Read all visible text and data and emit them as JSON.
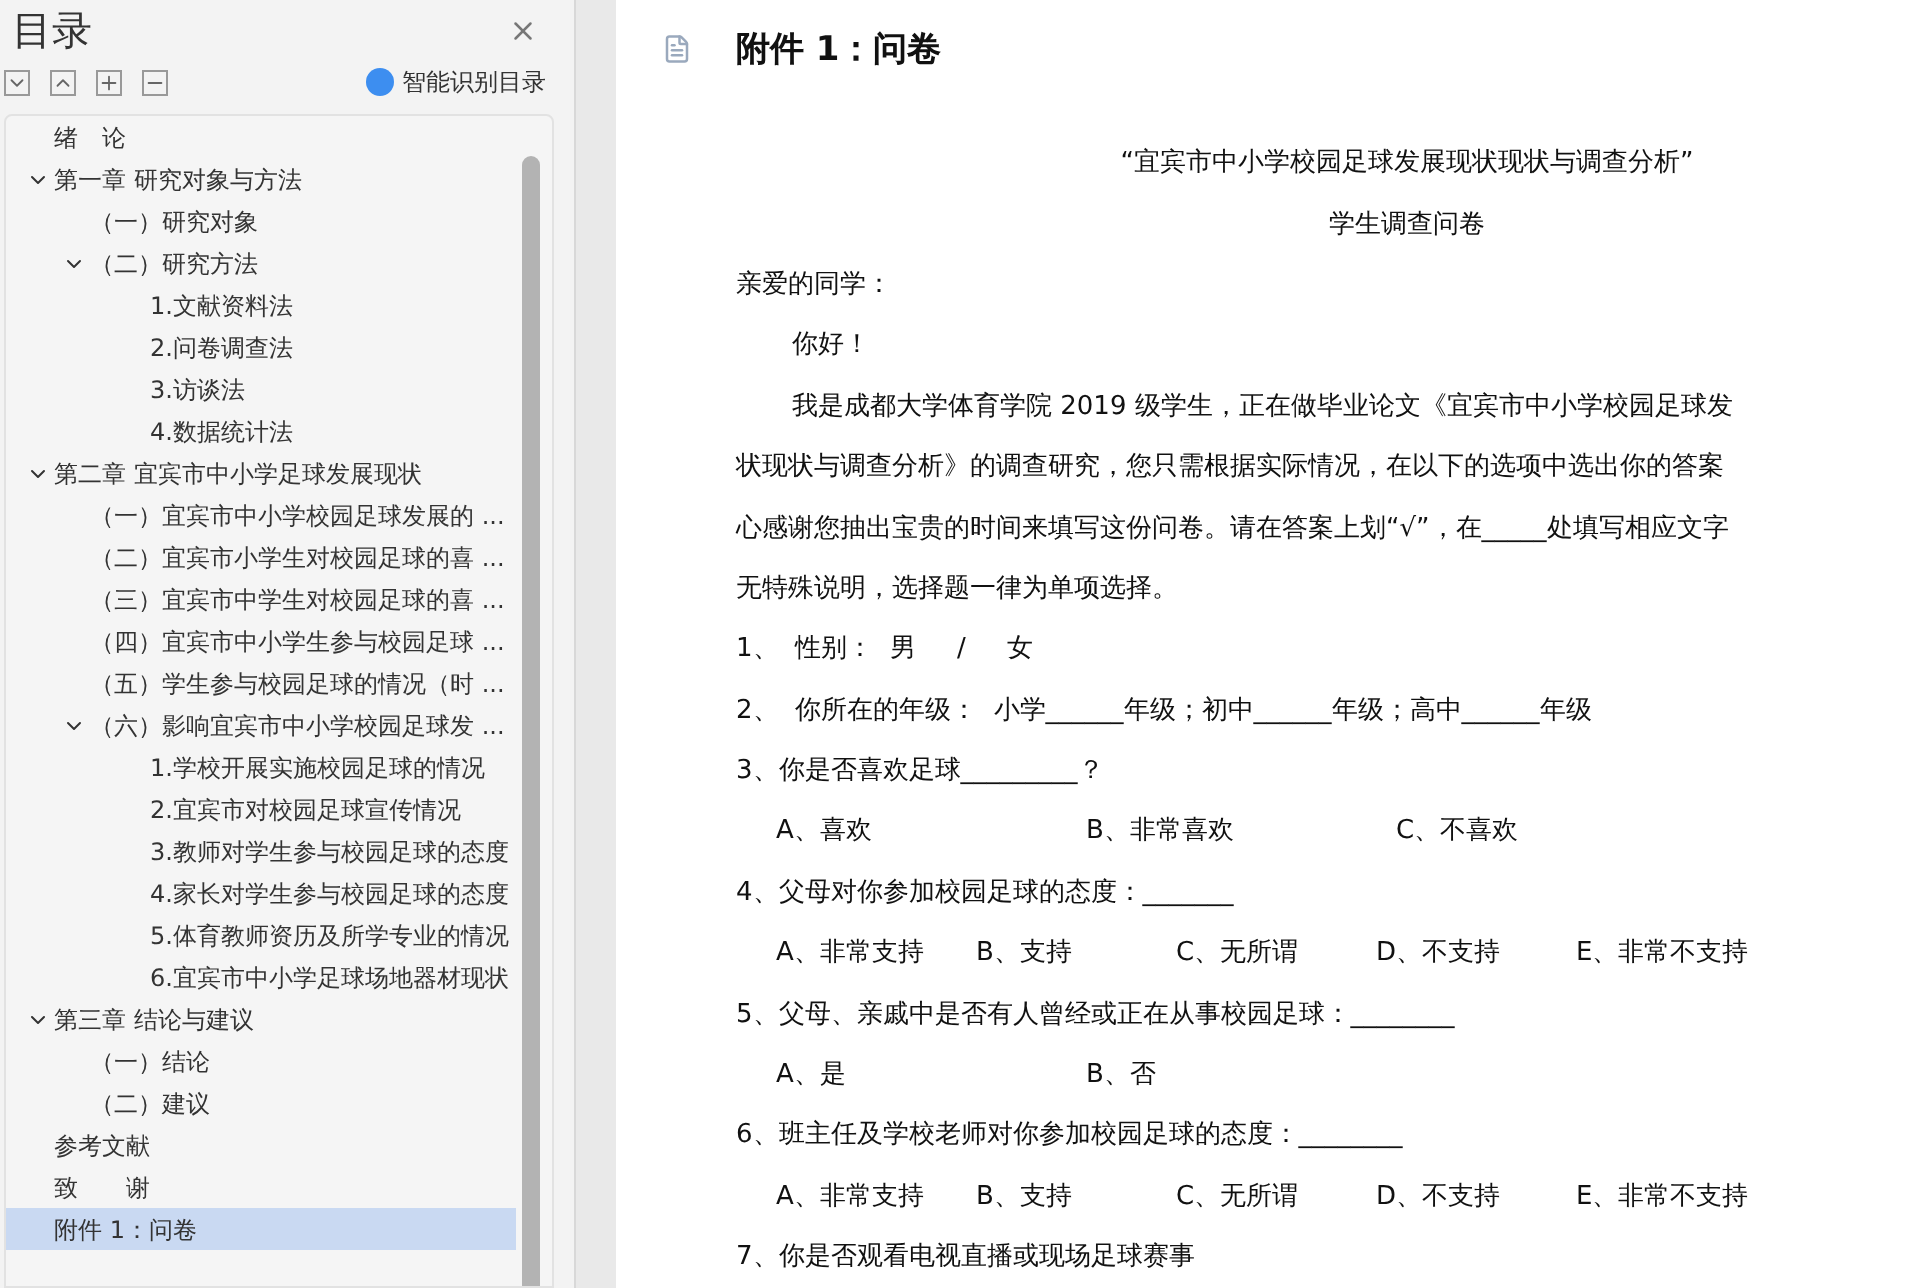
{
  "sidebar": {
    "title": "目录",
    "smart_button": "智能识别目录",
    "items": [
      {
        "label": "绪　论",
        "selected": false
      },
      {
        "label": "第一章  研究对象与方法",
        "expanded": true,
        "selected": false,
        "children": [
          {
            "label": "（一）研究对象",
            "selected": false
          },
          {
            "label": "（二）研究方法",
            "expanded": true,
            "selected": false,
            "children": [
              {
                "label": "1.文献资料法",
                "selected": false
              },
              {
                "label": "2.问卷调查法",
                "selected": false
              },
              {
                "label": "3.访谈法",
                "selected": false
              },
              {
                "label": "4.数据统计法",
                "selected": false
              }
            ]
          }
        ]
      },
      {
        "label": "第二章  宜宾市中小学足球发展现状",
        "expanded": true,
        "selected": false,
        "children": [
          {
            "label": "（一）宜宾市中小学校园足球发展的 ...",
            "selected": false
          },
          {
            "label": "（二）宜宾市小学生对校园足球的喜 ...",
            "selected": false
          },
          {
            "label": "（三）宜宾市中学生对校园足球的喜 ...",
            "selected": false
          },
          {
            "label": "（四）宜宾市中小学生参与校园足球 ...",
            "selected": false
          },
          {
            "label": "（五）学生参与校园足球的情况（时 ...",
            "selected": false
          },
          {
            "label": "（六）影响宜宾市中小学校园足球发 ...",
            "expanded": true,
            "selected": false,
            "children": [
              {
                "label": "1.学校开展实施校园足球的情况",
                "selected": false
              },
              {
                "label": "2.宜宾市对校园足球宣传情况",
                "selected": false
              },
              {
                "label": "3.教师对学生参与校园足球的态度",
                "selected": false
              },
              {
                "label": "4.家长对学生参与校园足球的态度",
                "selected": false
              },
              {
                "label": "5.体育教师资历及所学专业的情况",
                "selected": false
              },
              {
                "label": "6.宜宾市中小学足球场地器材现状",
                "selected": false
              }
            ]
          }
        ]
      },
      {
        "label": "第三章  结论与建议",
        "expanded": true,
        "selected": false,
        "children": [
          {
            "label": "（一）结论",
            "selected": false
          },
          {
            "label": "（二）建议",
            "selected": false
          }
        ]
      },
      {
        "label": "参考文献",
        "selected": false
      },
      {
        "label": "致　　谢",
        "selected": false
      },
      {
        "label": "附件 1：问卷",
        "selected": true
      }
    ]
  },
  "document": {
    "heading": "附件 1：问卷",
    "lines": [
      {
        "kind": "center",
        "text": "“宜宾市中小学校园足球发展现状现状与调查分析”"
      },
      {
        "kind": "center",
        "text": "学生调查问卷"
      },
      {
        "kind": "plain",
        "text": "亲爱的同学："
      },
      {
        "kind": "indent",
        "text": "你好！"
      },
      {
        "kind": "indent",
        "text": "我是成都大学体育学院 2019 级学生，正在做毕业论文《宜宾市中小学校园足球发"
      },
      {
        "kind": "plain",
        "text": "状现状与调查分析》的调查研究，您只需根据实际情况，在以下的选项中选出你的答案"
      },
      {
        "kind": "plain",
        "text": "心感谢您抽出宝贵的时间来填写这份问卷。请在答案上划“√”，在_____处填写相应文字"
      },
      {
        "kind": "plain",
        "text": "无特殊说明，选择题一律为单项选择。"
      },
      {
        "kind": "plain",
        "text": "1、  性别：  男     /     女"
      },
      {
        "kind": "plain",
        "text": "2、  你所在的年级：  小学______年级；初中______年级；高中______年级"
      },
      {
        "kind": "plain",
        "text": "3、你是否喜欢足球_________？"
      },
      {
        "kind": "options",
        "items": [
          "A、喜欢",
          "B、非常喜欢",
          "C、不喜欢"
        ]
      },
      {
        "kind": "plain",
        "text": "4、父母对你参加校园足球的态度：_______"
      },
      {
        "kind": "options",
        "items": [
          "A、非常支持",
          "B、支持",
          "C、无所谓",
          "D、不支持",
          "E、非常不支持"
        ]
      },
      {
        "kind": "plain",
        "text": "5、父母、亲戚中是否有人曾经或正在从事校园足球：________"
      },
      {
        "kind": "options",
        "items": [
          "A、是",
          "B、否"
        ]
      },
      {
        "kind": "plain",
        "text": "6、班主任及学校老师对你参加校园足球的态度：________"
      },
      {
        "kind": "options",
        "items": [
          "A、非常支持",
          "B、支持",
          "C、无所谓",
          "D、不支持",
          "E、非常不支持"
        ]
      },
      {
        "kind": "plain",
        "text": "7、你是否观看电视直播或现场足球赛事"
      }
    ]
  }
}
